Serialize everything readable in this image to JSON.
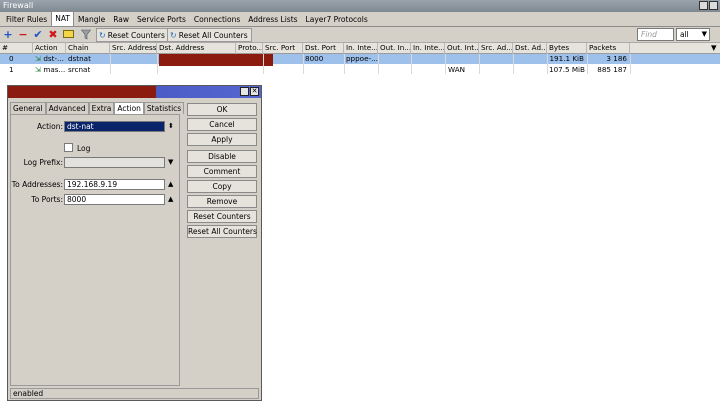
{
  "window": {
    "title": "Firewall"
  },
  "tabs": [
    "Filter Rules",
    "NAT",
    "Mangle",
    "Raw",
    "Service Ports",
    "Connections",
    "Address Lists",
    "Layer7 Protocols"
  ],
  "toolbar": {
    "reset_counters": "Reset Counters",
    "reset_all_counters": "Reset All Counters",
    "find_placeholder": "Find",
    "filter_value": "all"
  },
  "table": {
    "columns": [
      "#",
      "Action",
      "Chain",
      "Src. Address",
      "Dst. Address",
      "Proto...",
      "Src. Port",
      "Dst. Port",
      "In. Inte...",
      "Out. In...",
      "In. Inte...",
      "Out. Int...",
      "Src. Ad...",
      "Dst. Ad...",
      "Bytes",
      "Packets"
    ],
    "rows": [
      {
        "num": "0",
        "action": "dst-...",
        "chain": "dstnat",
        "dst_port": "8000",
        "in_interface": "pppoe-...",
        "out_interface_list": "",
        "bytes": "191.1 KiB",
        "packets": "3 186"
      },
      {
        "num": "1",
        "action": "mas...",
        "chain": "srcnat",
        "dst_port": "",
        "in_interface": "",
        "out_interface_list": "WAN",
        "bytes": "107.5 MiB",
        "packets": "885 187"
      }
    ]
  },
  "dialog": {
    "tabs": [
      "General",
      "Advanced",
      "Extra",
      "Action",
      "Statistics"
    ],
    "action_label": "Action:",
    "action_value": "dst-nat",
    "log_label": "Log",
    "log_prefix_label": "Log Prefix:",
    "to_addresses_label": "To Addresses:",
    "to_addresses_value": "192.168.9.19",
    "to_ports_label": "To Ports:",
    "to_ports_value": "8000",
    "buttons": [
      "OK",
      "Cancel",
      "Apply",
      "Disable",
      "Comment",
      "Copy",
      "Remove",
      "Reset Counters",
      "Reset All Counters"
    ],
    "status": "enabled"
  },
  "colors": {
    "selected_row": "#9ec1ec",
    "dialog_title": "#3f4fb8",
    "redaction": "#8b1a0f"
  }
}
